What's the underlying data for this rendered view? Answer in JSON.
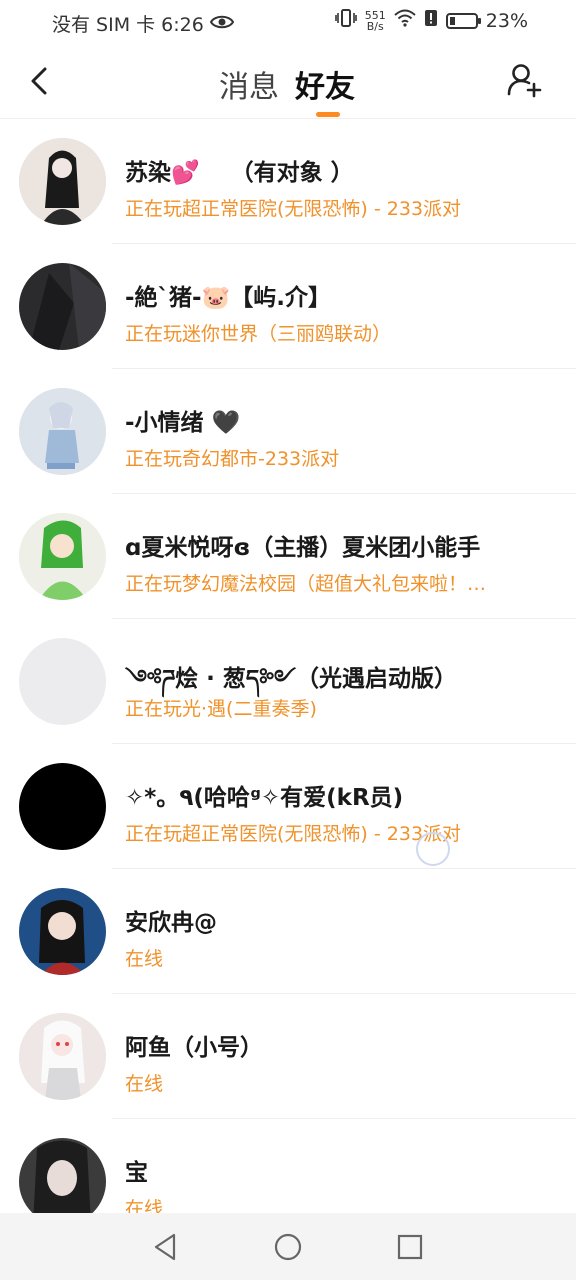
{
  "status_bar": {
    "left_text": "没有 SIM 卡 6:26",
    "net_speed_value": "551",
    "net_speed_unit": "B/s",
    "battery_percent": "23%",
    "battery_level": 0.23
  },
  "header": {
    "tab_messages": "消息",
    "tab_friends": "好友",
    "active_tab": "好友",
    "accent_color": "#ff8a1f"
  },
  "friends": [
    {
      "name": "苏染💕　 （有对象 ）",
      "status": "正在玩超正常医院(无限恐怖) - 233派对"
    },
    {
      "name": "-絶`猪-🐷【屿.介】",
      "status": "正在玩迷你世界（三丽鸥联动）"
    },
    {
      "name": "-小情绪 🖤",
      "status": "正在玩奇幻都市-233派对"
    },
    {
      "name": "ɑ夏米悦呀ɞ（主播）夏米团小能手",
      "status": "正在玩梦幻魔法校园（超值大礼包来啦！…"
    },
    {
      "name": "༺ཌ烩 · 葱ད༻（光遇启动版）",
      "status": "正在玩光·遇(二重奏季)"
    },
    {
      "name": "✧*。٩(哈哈ᵍ✧有爱(kR员)",
      "status": "正在玩超正常医院(无限恐怖) - 233派对"
    },
    {
      "name": "安欣冉@",
      "status": "在线"
    },
    {
      "name": "阿鱼（小号）",
      "status": "在线"
    },
    {
      "name": "宝",
      "status": "在线"
    }
  ],
  "colors": {
    "status_text": "#f0922b",
    "divider": "#eeeeee"
  }
}
